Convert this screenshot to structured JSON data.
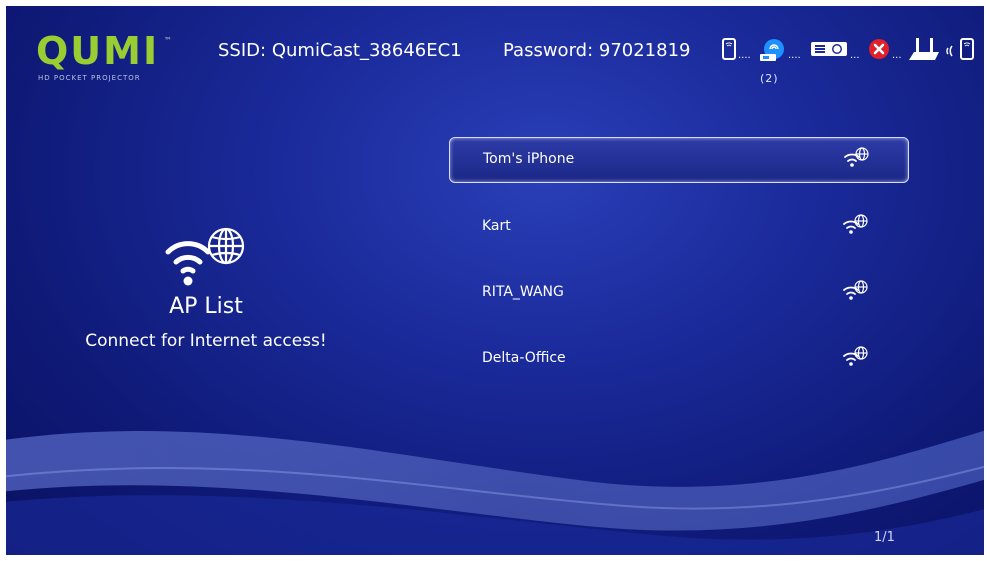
{
  "brand": {
    "logo_text": "QUMI",
    "tagline": "HD POCKET PROJECTOR"
  },
  "header": {
    "ssid_label": "SSID:",
    "ssid_value": "QumiCast_38646EC1",
    "password_label": "Password:",
    "password_value": "97021819"
  },
  "status_chain": {
    "icons": [
      "phone-icon",
      "cast-badge-icon",
      "projector-icon",
      "disconnected-icon",
      "router-icon",
      "wireless-icon",
      "phone-icon"
    ],
    "connected_count": "(2)",
    "colors": {
      "cast": "#1e90ff",
      "error": "#e0202b"
    }
  },
  "left_panel": {
    "icon": "wifi-globe-icon",
    "title": "AP List",
    "subtitle": "Connect for Internet access!"
  },
  "ap_list": {
    "items": [
      {
        "name": "Tom's iPhone",
        "icon": "wifi-globe-icon",
        "selected": true
      },
      {
        "name": "Kart",
        "icon": "wifi-globe-icon",
        "selected": false
      },
      {
        "name": "RITA_WANG",
        "icon": "wifi-globe-icon",
        "selected": false
      },
      {
        "name": "Delta-Office",
        "icon": "wifi-globe-icon",
        "selected": false
      }
    ]
  },
  "pager": {
    "text": "1/1"
  }
}
